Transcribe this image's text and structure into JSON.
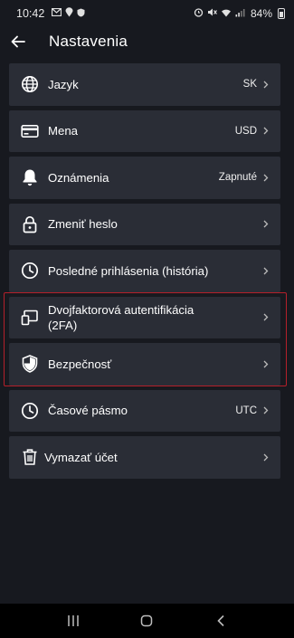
{
  "status_bar": {
    "time": "10:42",
    "battery": "84%"
  },
  "header": {
    "title": "Nastavenia"
  },
  "settings": [
    {
      "label": "Jazyk",
      "value": "SK",
      "icon": "globe-icon"
    },
    {
      "label": "Mena",
      "value": "USD",
      "icon": "credit-card-icon"
    },
    {
      "label": "Oznámenia",
      "value": "Zapnuté",
      "icon": "bell-icon"
    },
    {
      "label": "Zmeniť heslo",
      "value": "",
      "icon": "lock-icon"
    },
    {
      "label": "Posledné prihlásenia (história)",
      "value": "",
      "icon": "clock-icon"
    },
    {
      "label": "Dvojfaktorová autentifikácia (2FA)",
      "value": "",
      "icon": "two-devices-icon"
    },
    {
      "label": "Bezpečnosť",
      "value": "",
      "icon": "shield-icon"
    },
    {
      "label": "Časové pásmo",
      "value": "UTC",
      "icon": "clock-icon"
    },
    {
      "label": "Vymazať účet",
      "value": "",
      "icon": "trash-icon"
    }
  ],
  "colors": {
    "background": "#17191f",
    "card": "#2a2d36",
    "highlight": "#b4202a"
  }
}
